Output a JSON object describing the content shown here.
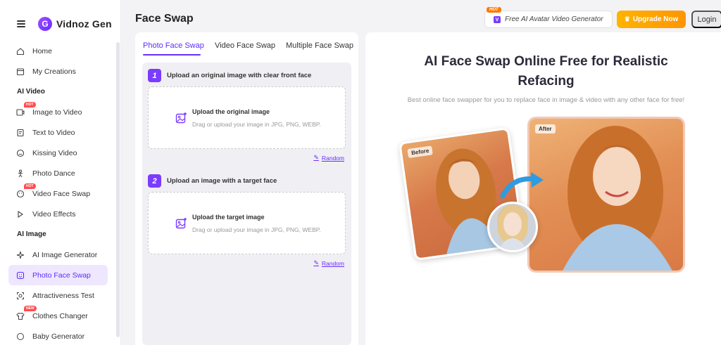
{
  "brand": {
    "name": "Vidnoz Gen",
    "logo_letter": "G"
  },
  "header": {
    "title": "Face Swap",
    "promo_badge": "HOT",
    "promo_text": "Free AI Avatar Video Generator",
    "upgrade_label": "Upgrade Now",
    "login_label": "Login"
  },
  "sidebar": {
    "top_items": [
      {
        "label": "Home",
        "icon": "home-icon"
      },
      {
        "label": "My Creations",
        "icon": "folder-icon"
      }
    ],
    "sections": [
      {
        "title": "AI Video",
        "items": [
          {
            "label": "Image to Video",
            "icon": "image-video-icon",
            "badge": "HOT"
          },
          {
            "label": "Text to Video",
            "icon": "text-video-icon"
          },
          {
            "label": "Kissing Video",
            "icon": "kiss-icon"
          },
          {
            "label": "Photo Dance",
            "icon": "dance-icon"
          },
          {
            "label": "Video Face Swap",
            "icon": "face-swap-icon",
            "badge": "HOT"
          },
          {
            "label": "Video Effects",
            "icon": "effects-icon"
          }
        ]
      },
      {
        "title": "AI Image",
        "items": [
          {
            "label": "AI Image Generator",
            "icon": "sparkle-icon"
          },
          {
            "label": "Photo Face Swap",
            "icon": "face-icon",
            "active": true
          },
          {
            "label": "Attractiveness Test",
            "icon": "scan-icon"
          },
          {
            "label": "Clothes Changer",
            "icon": "shirt-icon",
            "badge": "NEW"
          },
          {
            "label": "Baby Generator",
            "icon": "baby-icon"
          }
        ]
      }
    ]
  },
  "tabs": [
    "Photo Face Swap",
    "Video Face Swap",
    "Multiple Face Swap"
  ],
  "active_tab": "Photo Face Swap",
  "steps": [
    {
      "num": "1",
      "label": "Upload an original image with clear front face",
      "upload_title": "Upload the original image",
      "upload_sub": "Drag or upload your image in JPG, PNG, WEBP.",
      "random_label": "Random"
    },
    {
      "num": "2",
      "label": "Upload an image with a target face",
      "upload_title": "Upload the target image",
      "upload_sub": "Drag or upload your image in JPG, PNG, WEBP.",
      "random_label": "Random"
    }
  ],
  "hero": {
    "title_line1": "AI Face Swap Online Free for Realistic",
    "title_line2": "Refacing",
    "subtitle": "Best online face swapper for you to replace face in image & video with any other face for free!",
    "before_label": "Before",
    "after_label": "After"
  },
  "colors": {
    "accent": "#6a2cff",
    "upgrade": "#ffa000",
    "hot": "#ff4d4f"
  }
}
